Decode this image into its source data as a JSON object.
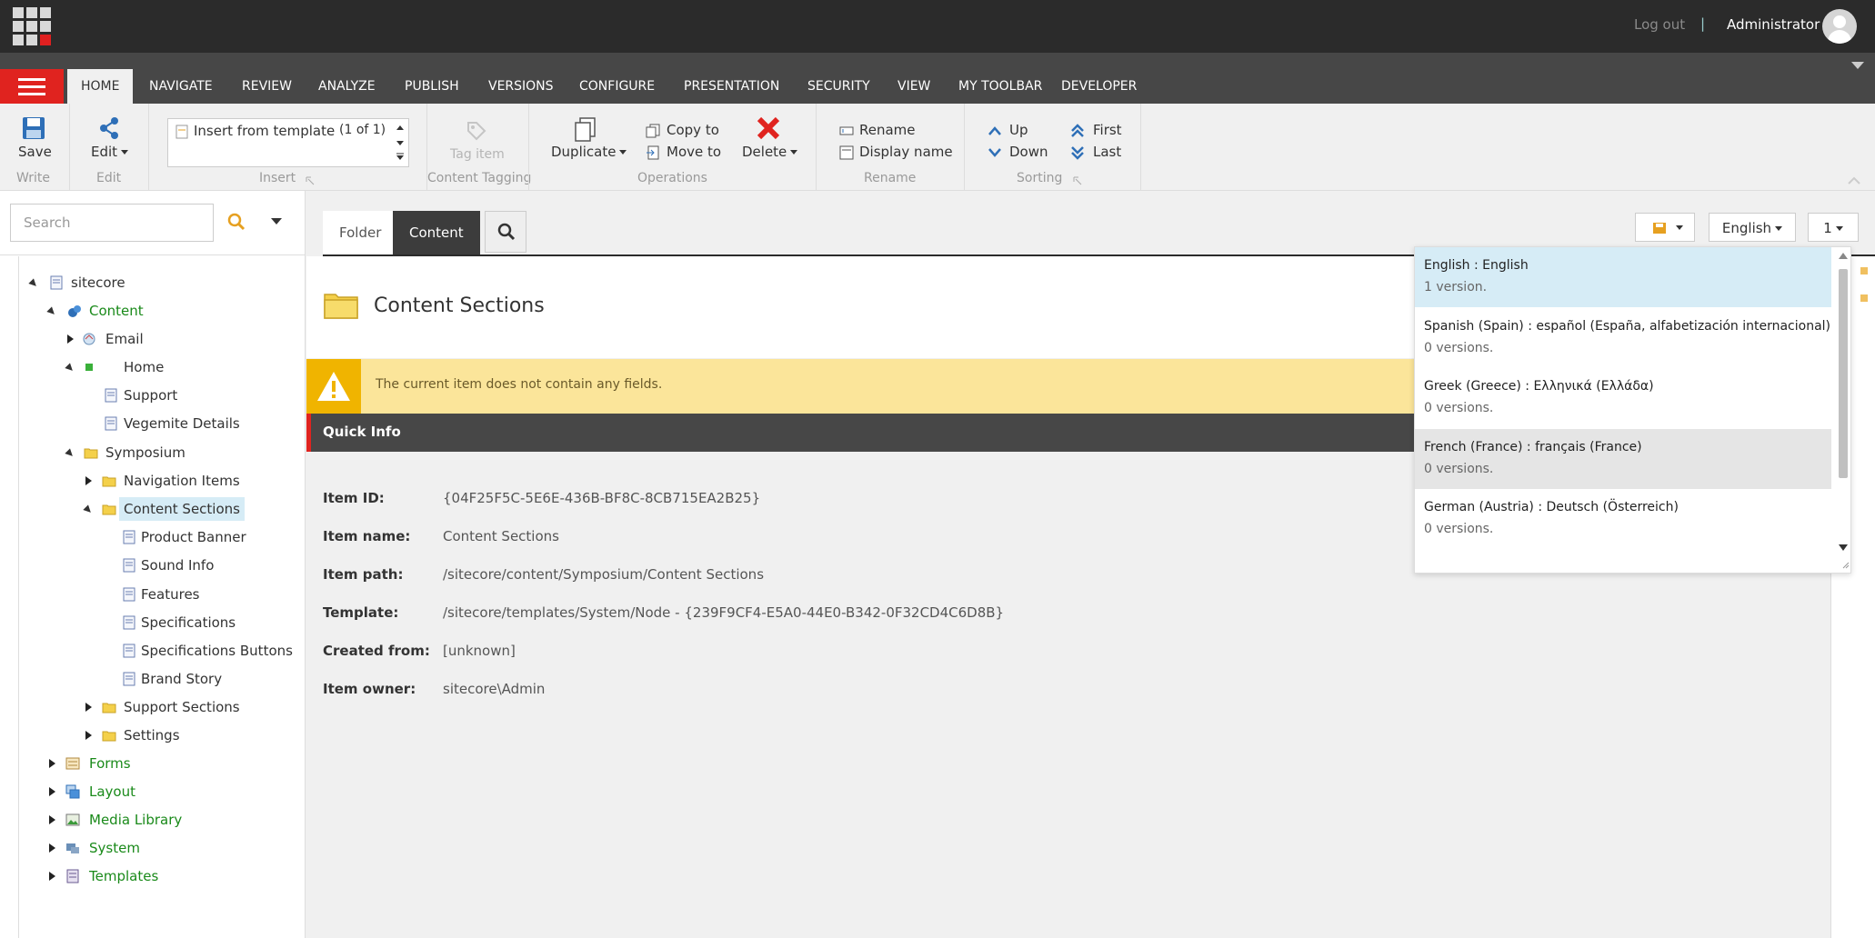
{
  "topbar": {
    "logout": "Log out",
    "separator": "|",
    "user": "Administrator"
  },
  "tabs": [
    "HOME",
    "NAVIGATE",
    "REVIEW",
    "ANALYZE",
    "PUBLISH",
    "VERSIONS",
    "CONFIGURE",
    "PRESENTATION",
    "SECURITY",
    "VIEW",
    "MY TOOLBAR",
    "DEVELOPER"
  ],
  "ribbon": {
    "save": "Save",
    "edit": "Edit",
    "insert_template": "Insert from template",
    "insert_count": "(1 of 1)",
    "tag_item": "Tag item",
    "duplicate": "Duplicate",
    "copy_to": "Copy to",
    "move_to": "Move to",
    "delete": "Delete",
    "rename": "Rename",
    "display_name": "Display name",
    "up": "Up",
    "down": "Down",
    "first": "First",
    "last": "Last",
    "groups": {
      "write": "Write",
      "edit": "Edit",
      "insert": "Insert",
      "tagging": "Content Tagging",
      "operations": "Operations",
      "rename": "Rename",
      "sorting": "Sorting"
    }
  },
  "search": {
    "placeholder": "Search"
  },
  "tree": [
    "sitecore",
    "Content",
    "Email",
    "Home",
    "Support",
    "Vegemite Details",
    "Symposium",
    "Navigation Items",
    "Content Sections",
    "Product Banner",
    "Sound Info",
    "Features",
    "Specifications",
    "Specifications Buttons",
    "Brand Story",
    "Support Sections",
    "Settings",
    "Forms",
    "Layout",
    "Media Library",
    "System",
    "Templates"
  ],
  "content": {
    "tab_folder": "Folder",
    "tab_content": "Content",
    "language_button": "English",
    "version_button": "1",
    "title": "Content Sections",
    "warning": "The current item does not contain any fields.",
    "quick_info": "Quick Info",
    "info": [
      {
        "label": "Item ID:",
        "value": "{04F25F5C-5E6E-436B-BF8C-8CB715EA2B25}"
      },
      {
        "label": "Item name:",
        "value": "Content Sections"
      },
      {
        "label": "Item path:",
        "value": "/sitecore/content/Symposium/Content Sections"
      },
      {
        "label": "Template:",
        "value": "/sitecore/templates/System/Node - {239F9CF4-E5A0-44E0-B342-0F32CD4C6D8B}"
      },
      {
        "label": "Created from:",
        "value": "[unknown]"
      },
      {
        "label": "Item owner:",
        "value": "sitecore\\Admin"
      }
    ]
  },
  "languages": [
    {
      "name": "English : English",
      "versions": "1 version."
    },
    {
      "name": "Spanish (Spain) : español (España, alfabetización internacional)",
      "versions": "0 versions."
    },
    {
      "name": "Greek (Greece) : Ελληνικά (Ελλάδα)",
      "versions": "0 versions."
    },
    {
      "name": "French (France) : français (France)",
      "versions": "0 versions."
    },
    {
      "name": "German (Austria) : Deutsch (Österreich)",
      "versions": "0 versions."
    }
  ]
}
